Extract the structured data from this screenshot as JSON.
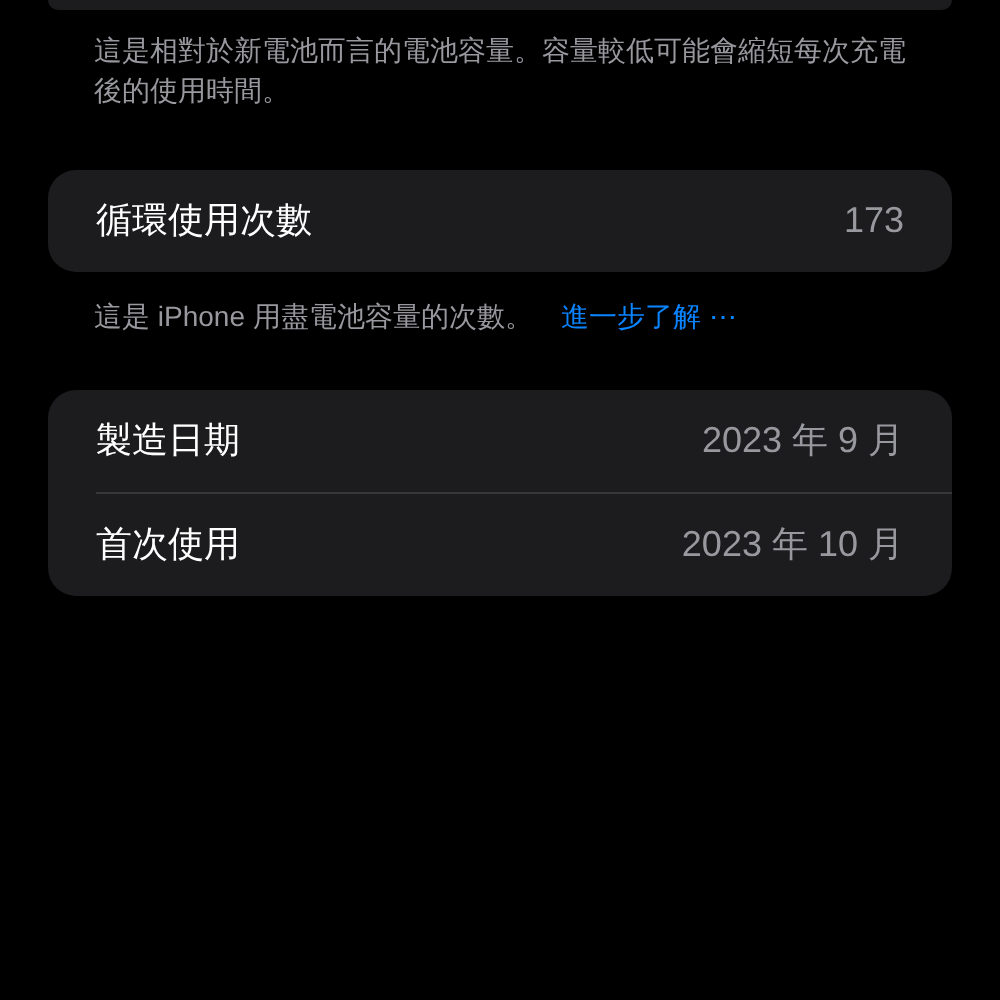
{
  "capacity_note": "這是相對於新電池而言的電池容量。容量較低可能會縮短每次充電後的使用時間。",
  "cycle_count": {
    "label": "循環使用次數",
    "value": "173"
  },
  "cycle_note": {
    "text": "這是 iPhone 用盡電池容量的次數。",
    "link": "進一步了解 ⋯"
  },
  "dates": [
    {
      "label": "製造日期",
      "value": "2023 年 9 月"
    },
    {
      "label": "首次使用",
      "value": "2023 年 10 月"
    }
  ]
}
